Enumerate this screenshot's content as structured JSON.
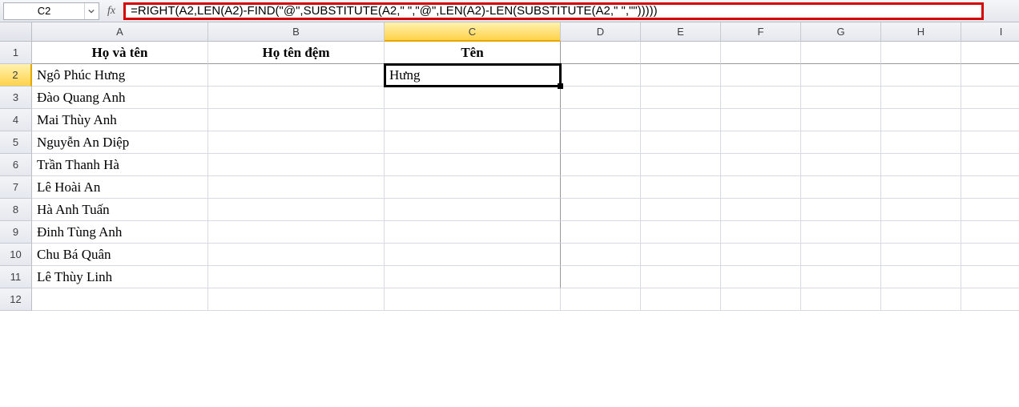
{
  "nameBox": "C2",
  "fxLabel": "fx",
  "formula": "=RIGHT(A2,LEN(A2)-FIND(\"@\",SUBSTITUTE(A2,\" \",\"@\",LEN(A2)-LEN(SUBSTITUTE(A2,\" \",\"\")))))",
  "columns": [
    "A",
    "B",
    "C",
    "D",
    "E",
    "F",
    "G",
    "H",
    "I"
  ],
  "rows": [
    "1",
    "2",
    "3",
    "4",
    "5",
    "6",
    "7",
    "8",
    "9",
    "10",
    "11",
    "12"
  ],
  "selectedCol": "C",
  "selectedRow": "2",
  "headersRow": {
    "A": "Họ và tên",
    "B": "Họ tên đệm",
    "C": "Tên"
  },
  "dataA": {
    "2": "Ngô Phúc Hưng",
    "3": "Đào Quang Anh",
    "4": "Mai Thùy Anh",
    "5": "Nguyễn An Diệp",
    "6": "Trần Thanh Hà",
    "7": "Lê Hoài An",
    "8": "Hà Anh Tuấn",
    "9": "Đinh Tùng Anh",
    "10": "Chu Bá Quân",
    "11": "Lê Thùy Linh"
  },
  "dataC": {
    "2": "Hưng"
  }
}
